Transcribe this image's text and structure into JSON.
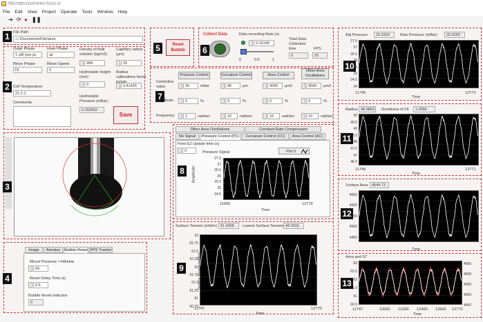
{
  "window": {
    "title": "Microtensiometer.lvsvi.vi",
    "menu": [
      "File",
      "Edit",
      "View",
      "Project",
      "Operate",
      "Tools",
      "Window",
      "Help"
    ]
  },
  "icons": {
    "run_arrow": "arrow-right-icon",
    "run_cont": "loop-icon",
    "abort": "stop-icon",
    "pause": "pause-icon"
  },
  "p1": {
    "num": "1",
    "file_path_label": "File Path",
    "file_path": "Documents\\Filename"
  },
  "p2": {
    "num": "2",
    "outer_phase_label": "Outer Phase",
    "outer_phase": "1 uM lyso pc",
    "inner_phase_label": "Inner Phase",
    "inner_phase": "air",
    "rinse_phase_label": "Rinse Phase",
    "rinse_phase": "DI",
    "rinse_speed_label": "Rinse Speed",
    "rinse_speed": "0",
    "density_label": "Density of bulk solution (kg/m3)",
    "density": "998",
    "capillary_label": "Capillary radius (µm)",
    "capillary": "25",
    "hydro_height_label": "Hydrostatic height (mm)",
    "hydro_height": "0",
    "radius_cal_label": "Radius calibrations factor px/µm",
    "radius_cal": "3.41426",
    "cell_temp_label": "Cell Temperature",
    "cell_temp": "21.2 C",
    "comments_label": "Comments",
    "hydro_pressure_label": "Hydrostatic Pressure (mBar)",
    "hydro_pressure": "0.293562",
    "save_label": "Save"
  },
  "p3": {
    "num": "3"
  },
  "p4": {
    "num": "4",
    "tabs": [
      "Image",
      "Annulus",
      "Bubble Reset",
      "FPS Tracker"
    ],
    "reset_pressure_label": "REset Pressure <=Mmbar",
    "reset_pressure": "69",
    "reset_delay_label": "Reset Delay Time (s)",
    "reset_delay": "0.5",
    "indicator_label": "Bubble Reset Indicator",
    "indicator": "0"
  },
  "p5": {
    "num": "5",
    "reset_bubble": "Reset Bubble"
  },
  "p6": {
    "num": "6",
    "collect_label": "Collect Data",
    "rate_label": "Data recording Rate (s)",
    "rate": "0.19148",
    "slider_ticks": [
      "0",
      "0.5",
      "1"
    ],
    "total_label": "Total Data Collection time",
    "total": "0",
    "fps_label": "FPS",
    "fps": "25"
  },
  "p7": {
    "num": "7",
    "headers": [
      "Pressure Control",
      "Curvature Control",
      "Area Control",
      "Other Area Oscillations"
    ],
    "row_labels": [
      "Centerline value",
      "Amplitude",
      "Frequency"
    ],
    "centerline": [
      "26",
      "45",
      "4500",
      "4500"
    ],
    "centerline_units": [
      "mbar",
      "µm",
      "µm2",
      "µm2"
    ],
    "amplitude": [
      "5",
      "0",
      "0",
      "0"
    ],
    "amplitude_units": [
      "%",
      "%",
      "%",
      "%"
    ],
    "frequency": [
      "1",
      "10",
      "10",
      "10"
    ],
    "frequency_units": [
      "rad/sec",
      "rad/sec",
      "rad/sec",
      "rad/sec"
    ]
  },
  "p8": {
    "num": "8",
    "tabs_row1": [
      "Other Area Oscillations",
      "Constant Rate Compression"
    ],
    "tabs_row2": [
      "No Signal",
      "Pressure Control (PC)",
      "Curvature Control (CC)",
      "Area Control (AC)"
    ],
    "flow_label": "Flow EZ Update time (s)",
    "flow": "0",
    "plot_title": "Pressure Signal",
    "plot_legend": "Plot 0",
    "y_ticks": [
      "27.5",
      "27",
      "26.5",
      "26",
      "25.5",
      "25",
      "24.5"
    ],
    "x_start": "11696",
    "x_end": "12719",
    "xlabel": "Time",
    "ylabel": "Amplitude"
  },
  "p9": {
    "num": "9",
    "st_label": "Surface Tension (mN/m)",
    "st": "61.5405",
    "lowest_label": "Lowest Surface Tension",
    "lowest": "44.3316",
    "y_ticks": [
      "63",
      "62.75",
      "62.5",
      "62.25",
      "62",
      "61.75",
      "61.5",
      "61.25",
      "61",
      "60.75"
    ],
    "x_ticks": [
      "11747",
      "",
      "",
      "",
      "",
      "",
      "12770"
    ],
    "xlabel": "Time",
    "ylabel": "Surface Tension (mN/m)"
  },
  "p10": {
    "num": "10",
    "adj_label": "Adj Pressure",
    "adj": "25.3324",
    "raw_label": "Raw Pressure (mBar)",
    "raw": "25.6259",
    "y_ticks": [
      "27.5",
      "27",
      "26.5",
      "26",
      "25.5",
      "25",
      "24.5",
      "24"
    ],
    "x_start": "11749",
    "x_end": "12772",
    "xlabel": "Time",
    "ylabel": "Pressure"
  },
  "p11": {
    "num": "11",
    "radius_label": "Radius",
    "radius": "48.5863",
    "gof_label": "Goodness of Fit",
    "gof": "1.0066",
    "y_ticks": [
      "50",
      "49.5",
      "49",
      "48.5",
      "48",
      "47.5",
      "47",
      "46.5"
    ],
    "x_start": "11748",
    "x_end": "12771",
    "xlabel": "Time",
    "ylabel": "Radius"
  },
  "p12": {
    "num": "12",
    "area_label": "Surface Area",
    "area": "4544.72",
    "y_ticks": [
      "4650",
      "4600",
      "4550",
      "4500",
      "4450"
    ],
    "x_start": "11749",
    "x_end": "12772",
    "xlabel": "Time",
    "ylabel": "Surface Area (µm2)"
  },
  "p13": {
    "num": "13",
    "label": "Area and ST",
    "y_ticks": [
      "63",
      "62.5",
      "62",
      "61.5",
      "61",
      "60.5"
    ],
    "y2_ticks": [
      "4650",
      "4600",
      "4550",
      "4500",
      "4450"
    ],
    "x_ticks": [
      "11747",
      "12000",
      "12200",
      "12400",
      "12600",
      "12770"
    ],
    "xlabel": "Time",
    "ylabel": "Surface Tension",
    "y2label": "Surface Area (µm2)"
  },
  "chart_data": [
    {
      "type": "line",
      "title": "Pressure Signal",
      "xlabel": "Time",
      "ylabel": "Amplitude",
      "x_range": [
        11696,
        12719
      ],
      "ylim": [
        24.5,
        27.5
      ],
      "series": [
        {
          "name": "Plot 0",
          "center": 26,
          "amplitude": 1.3,
          "cycles": 6.5
        }
      ]
    },
    {
      "type": "line",
      "xlabel": "Time",
      "ylabel": "Surface Tension (mN/m)",
      "x_range": [
        11747,
        12770
      ],
      "ylim": [
        60.75,
        63
      ],
      "series": [
        {
          "center": 62,
          "amplitude": 0.65,
          "cycles": 7.5
        }
      ]
    },
    {
      "type": "line",
      "xlabel": "Time",
      "ylabel": "Pressure",
      "x_range": [
        11749,
        12772
      ],
      "ylim": [
        24,
        27.5
      ],
      "series": [
        {
          "center": 25.8,
          "amplitude": 1.4,
          "cycles": 7.5
        }
      ]
    },
    {
      "type": "line",
      "xlabel": "Time",
      "ylabel": "Radius",
      "x_range": [
        11748,
        12771
      ],
      "ylim": [
        46.5,
        50
      ],
      "series": [
        {
          "center": 48.4,
          "amplitude": 1.4,
          "cycles": 7.5
        }
      ]
    },
    {
      "type": "line",
      "xlabel": "Time",
      "ylabel": "Surface Area (µm2)",
      "x_range": [
        11749,
        12772
      ],
      "ylim": [
        4450,
        4650
      ],
      "series": [
        {
          "center": 4550,
          "amplitude": 80,
          "cycles": 7.5
        }
      ]
    },
    {
      "type": "line",
      "xlabel": "Time",
      "ylabel": "Surface Tension",
      "x_range": [
        11747,
        12770
      ],
      "ylim": [
        60.5,
        63
      ],
      "series": [
        {
          "center": 61.8,
          "amplitude": 0.8,
          "cycles": 7.5,
          "color": "#e05050"
        },
        {
          "center": 61.8,
          "amplitude": 0.7,
          "cycles": 7.5,
          "color": "#ffffff"
        }
      ]
    }
  ]
}
